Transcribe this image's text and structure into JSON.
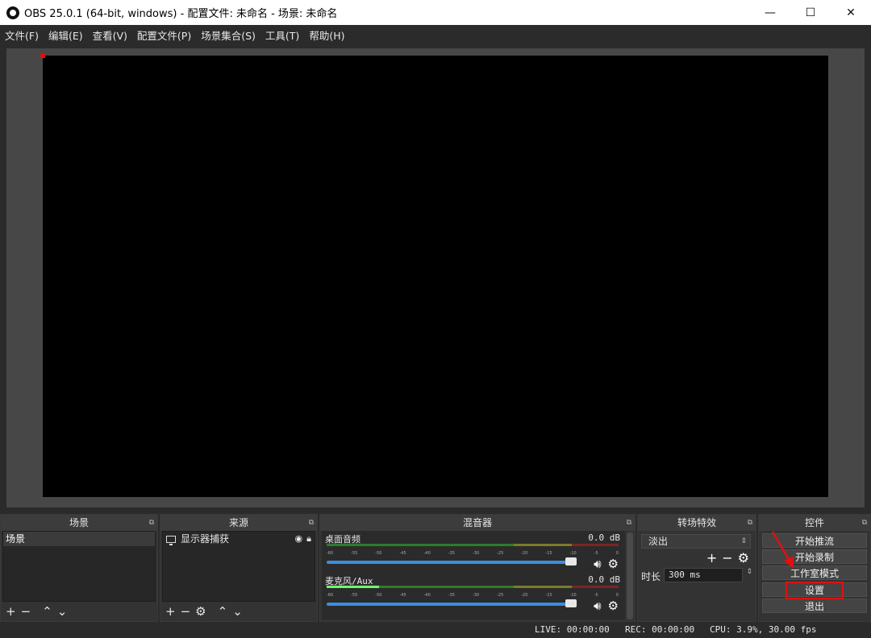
{
  "window": {
    "title": "OBS 25.0.1 (64-bit, windows) - 配置文件: 未命名 - 场景: 未命名",
    "minimize": "—",
    "maximize": "☐",
    "close": "✕"
  },
  "menu": [
    "文件(F)",
    "编辑(E)",
    "查看(V)",
    "配置文件(P)",
    "场景集合(S)",
    "工具(T)",
    "帮助(H)"
  ],
  "docks": {
    "scenes": {
      "title": "场景",
      "items": [
        "场景"
      ]
    },
    "sources": {
      "title": "来源",
      "items": [
        {
          "label": "显示器捕获",
          "icon": "monitor-icon"
        }
      ]
    },
    "mixer": {
      "title": "混音器",
      "channels": [
        {
          "name": "桌面音频",
          "db": "0.0 dB",
          "level": 0
        },
        {
          "name": "麦克风/Aux",
          "db": "0.0 dB",
          "level": 0.18
        }
      ],
      "ticks": [
        "-60",
        "-55",
        "-50",
        "-45",
        "-40",
        "-35",
        "-30",
        "-25",
        "-20",
        "-15",
        "-10",
        "-5",
        "0"
      ]
    },
    "transitions": {
      "title": "转场特效",
      "selected": "淡出",
      "duration_label": "时长",
      "duration_value": "300 ms"
    },
    "controls": {
      "title": "控件",
      "buttons": [
        "开始推流",
        "开始录制",
        "工作室模式",
        "设置",
        "退出"
      ]
    }
  },
  "status": {
    "live": "LIVE: 00:00:00",
    "rec": "REC: 00:00:00",
    "cpu": "CPU: 3.9%, 30.00 fps"
  },
  "annotation": {
    "color": "#e01010"
  }
}
